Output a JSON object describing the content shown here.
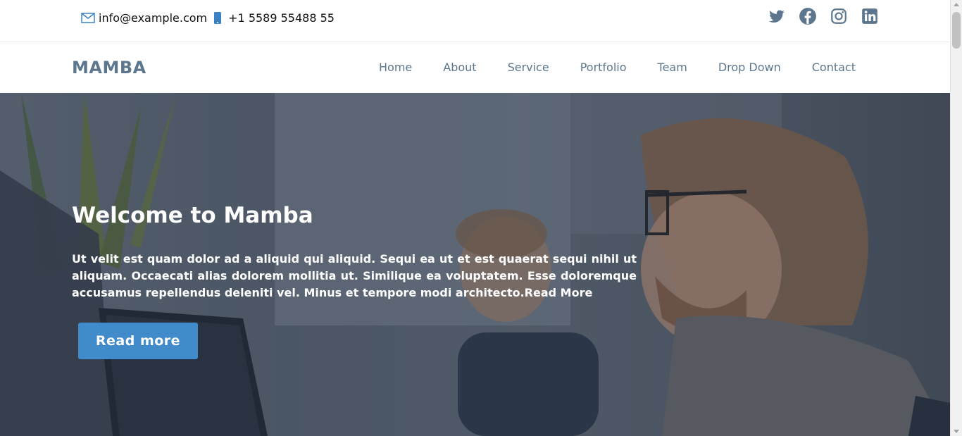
{
  "topbar": {
    "email": "info@example.com",
    "phone": "+1 5589 55488 55",
    "social": [
      {
        "icon": "twitter-icon"
      },
      {
        "icon": "facebook-icon"
      },
      {
        "icon": "instagram-icon"
      },
      {
        "icon": "linkedin-icon"
      }
    ]
  },
  "header": {
    "logo": "MAMBA",
    "nav": [
      "Home",
      "About",
      "Service",
      "Portfolio",
      "Team",
      "Drop Down",
      "Contact"
    ]
  },
  "hero": {
    "title": "Welcome to Mamba",
    "text": "Ut velit est quam dolor ad a aliquid qui aliquid. Sequi ea ut et est quaerat sequi nihil ut aliquam. Occaecati alias dolorem mollitia ut. Similique ea voluptatem. Esse doloremque accusamus repellendus deleniti vel. Minus et tempore modi architecto.Read More",
    "button": "Read more"
  },
  "colors": {
    "accent": "#428bca",
    "nav_text": "#5c768d",
    "icon_blue": "#3b82c4"
  }
}
